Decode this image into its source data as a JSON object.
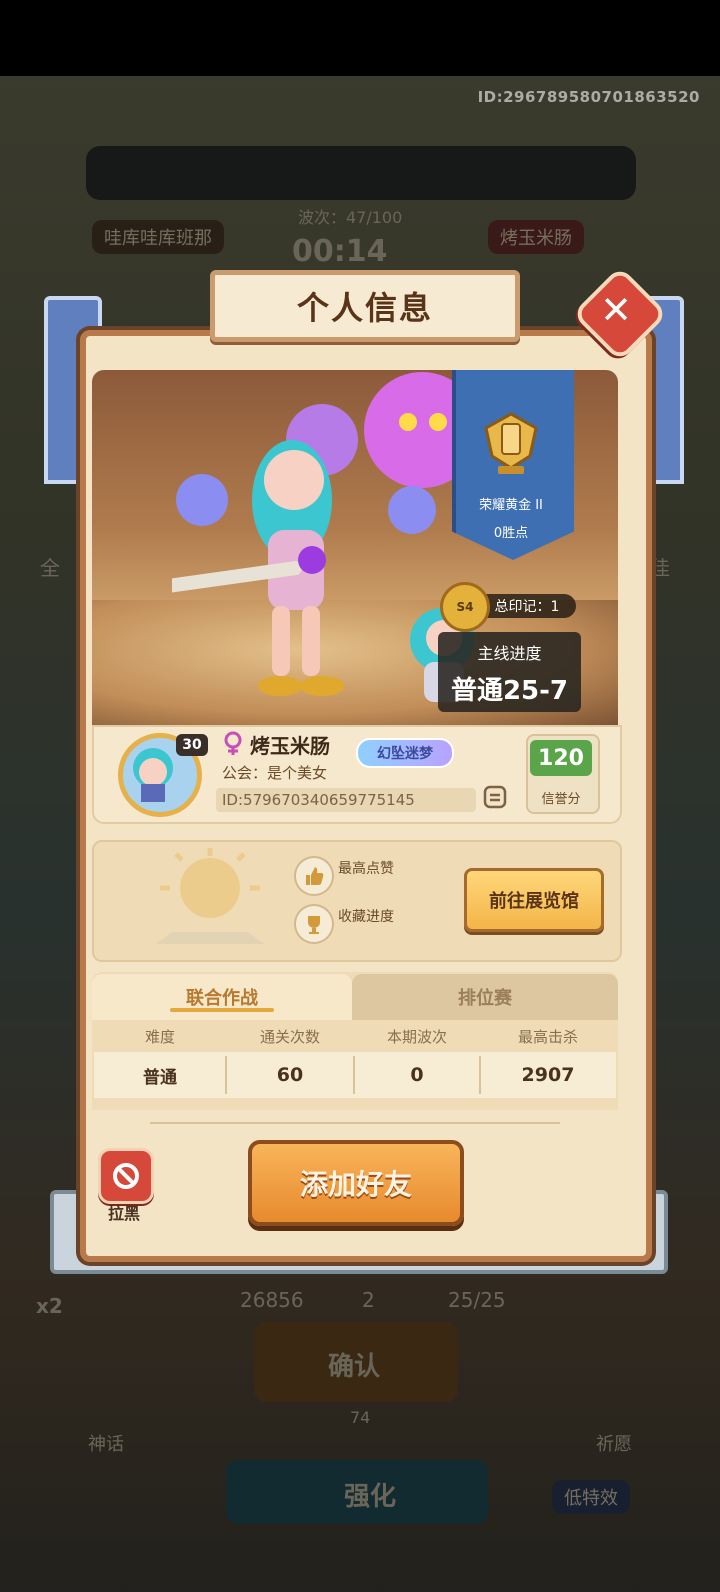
{
  "top_id": "ID:296789580701863520",
  "background": {
    "p1_name": "哇库哇库班那",
    "wave": "波次：47/100",
    "timer": "00:14",
    "p2_name": "烤玉米肠",
    "left_label": "全",
    "right_label": "佳",
    "stat_a": "26856",
    "stat_b": "2",
    "stat_c": "25/25",
    "confirm": "确认",
    "confirm_count": "74",
    "myth": "神话",
    "pray": "祈愿",
    "enhance": "强化",
    "low_fx": "低特效",
    "speed": "x2"
  },
  "dialog": {
    "title": "个人信息",
    "rank": {
      "name": "荣耀黄金 II",
      "points": "0胜点"
    },
    "season_badge": "S4",
    "seal_count": "总印记：1",
    "progress": {
      "label": "主线进度",
      "value": "普通25-7"
    },
    "profile": {
      "level": "30",
      "name": "烤玉米肠",
      "title_badge": "幻坠迷梦",
      "guild": "公会：是个美女",
      "id": "ID:579670340659775145",
      "credit_value": "120",
      "credit_label": "信誉分"
    },
    "gallery": {
      "likes_label": "最高点赞",
      "collect_label": "收藏进度",
      "button": "前往展览馆"
    },
    "tabs": [
      {
        "label": "联合作战",
        "active": true
      },
      {
        "label": "排位赛",
        "active": false
      }
    ],
    "table": {
      "headers": [
        "难度",
        "通关次数",
        "本期波次",
        "最高击杀"
      ],
      "row": [
        "普通",
        "60",
        "0",
        "2907"
      ]
    },
    "block_label": "拉黑",
    "add_friend": "添加好友"
  },
  "colors": {
    "accent_orange": "#e78a2e",
    "danger_red": "#d6483a",
    "rank_blue": "#3f6fb3",
    "credit_green": "#5aa54a"
  }
}
